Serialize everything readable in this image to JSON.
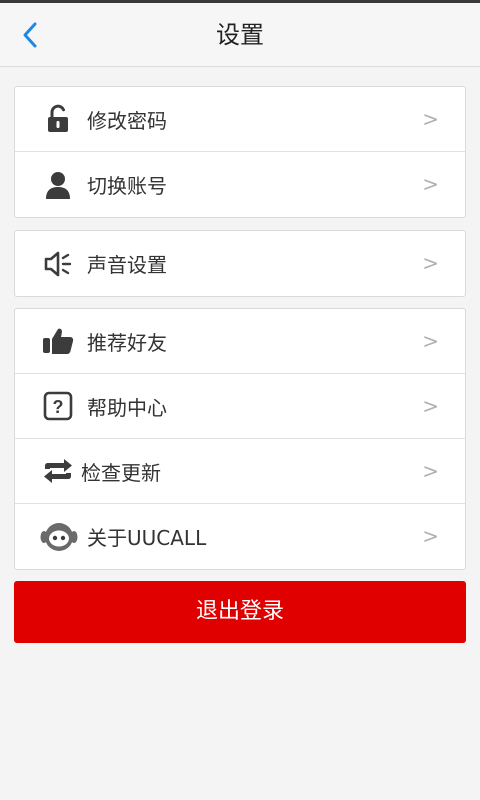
{
  "header": {
    "title": "设置",
    "back_icon": "chevron-left-icon"
  },
  "groups": [
    {
      "items": [
        {
          "label": "修改密码",
          "icon": "unlock-icon",
          "arrow": ">"
        },
        {
          "label": "切换账号",
          "icon": "user-icon",
          "arrow": ">"
        }
      ]
    },
    {
      "items": [
        {
          "label": "声音设置",
          "icon": "speaker-icon",
          "arrow": ">"
        }
      ]
    },
    {
      "items": [
        {
          "label": "推荐好友",
          "icon": "thumbs-up-icon",
          "arrow": ">"
        },
        {
          "label": "帮助中心",
          "icon": "help-icon",
          "arrow": ">"
        },
        {
          "label": "检查更新",
          "icon": "refresh-icon",
          "arrow": ">"
        },
        {
          "label": "关于UUCALL",
          "icon": "mascot-icon",
          "arrow": ">"
        }
      ]
    }
  ],
  "logout_label": "退出登录",
  "colors": {
    "accent": "#1e88e5",
    "logout": "#e00000",
    "icon": "#3c3c3c"
  }
}
